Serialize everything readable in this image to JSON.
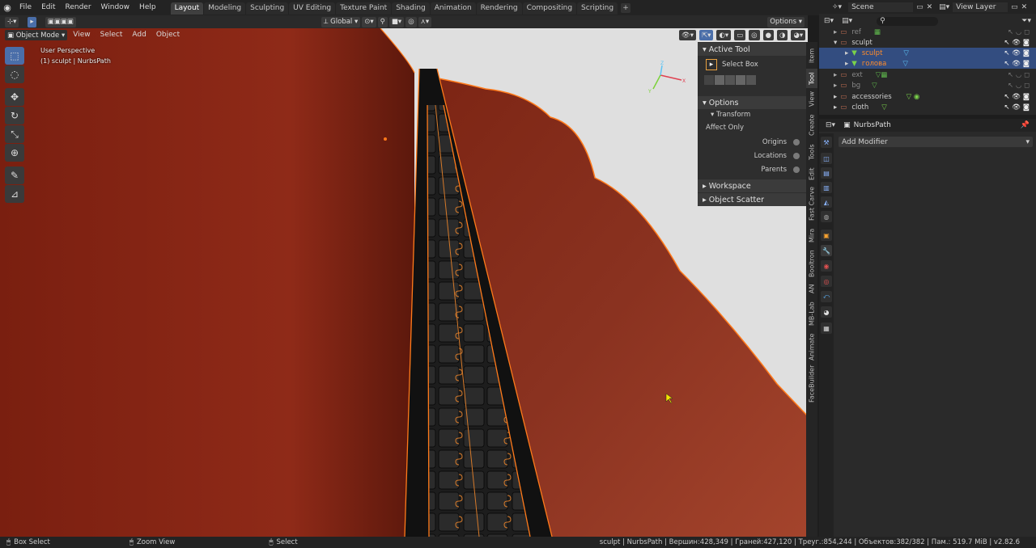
{
  "menu": {
    "file": "File",
    "edit": "Edit",
    "render": "Render",
    "window": "Window",
    "help": "Help"
  },
  "workspaces": [
    "Layout",
    "Modeling",
    "Sculpting",
    "UV Editing",
    "Texture Paint",
    "Shading",
    "Animation",
    "Rendering",
    "Compositing",
    "Scripting"
  ],
  "active_workspace": "Layout",
  "viewport_header": {
    "orientation": "Global",
    "options": "Options"
  },
  "mode_bar": {
    "mode": "Object Mode",
    "view": "View",
    "select": "Select",
    "add": "Add",
    "object": "Object"
  },
  "viewport": {
    "perspective": "User Perspective",
    "object_info": "(1) sculpt | NurbsPath",
    "axis_x": "X",
    "axis_y": "Y",
    "axis_z": "Z"
  },
  "npanel": {
    "active_tool_title": "Active Tool",
    "tool_name": "Select Box",
    "options_title": "Options",
    "transform_title": "Transform",
    "affect_only": "Affect Only",
    "origins": "Origins",
    "locations": "Locations",
    "parents": "Parents",
    "workspace_title": "Workspace",
    "object_scatter_title": "Object Scatter"
  },
  "side_tabs": [
    "Item",
    "Tool",
    "View",
    "Create",
    "Tools",
    "Edit",
    "Fast Carve",
    "Mira",
    "Booltron",
    "AN",
    "MB-Lab",
    "Animate",
    "FaceBuilder"
  ],
  "active_side_tab": "Tool",
  "scene": {
    "name": "Scene",
    "view_layer": "View Layer"
  },
  "outliner": {
    "rows": [
      {
        "name": "ref",
        "muted": true
      },
      {
        "name": "sculpt",
        "muted": false
      },
      {
        "name": "sculpt",
        "muted": false,
        "selected": true,
        "orange": true
      },
      {
        "name": "голова",
        "muted": false,
        "selected": true,
        "orange": true
      },
      {
        "name": "ext",
        "muted": true
      },
      {
        "name": "bg",
        "muted": true
      },
      {
        "name": "accessories",
        "muted": false
      },
      {
        "name": "cloth",
        "muted": false
      }
    ]
  },
  "properties": {
    "object": "NurbsPath",
    "add_modifier": "Add Modifier"
  },
  "status": {
    "box_select": "Box Select",
    "zoom_view": "Zoom View",
    "select": "Select",
    "stats": "sculpt | NurbsPath | Вершин:428,349 | Граней:427,120 | Треуг.:854,244 | Объектов:382/382 | Пам.: 519.7 MiB | v2.82.6"
  },
  "colors": {
    "accent": "#4a6ea9",
    "cloth": "#8b2a1a",
    "outline": "#ff7a1a",
    "selection": "#334d80"
  }
}
